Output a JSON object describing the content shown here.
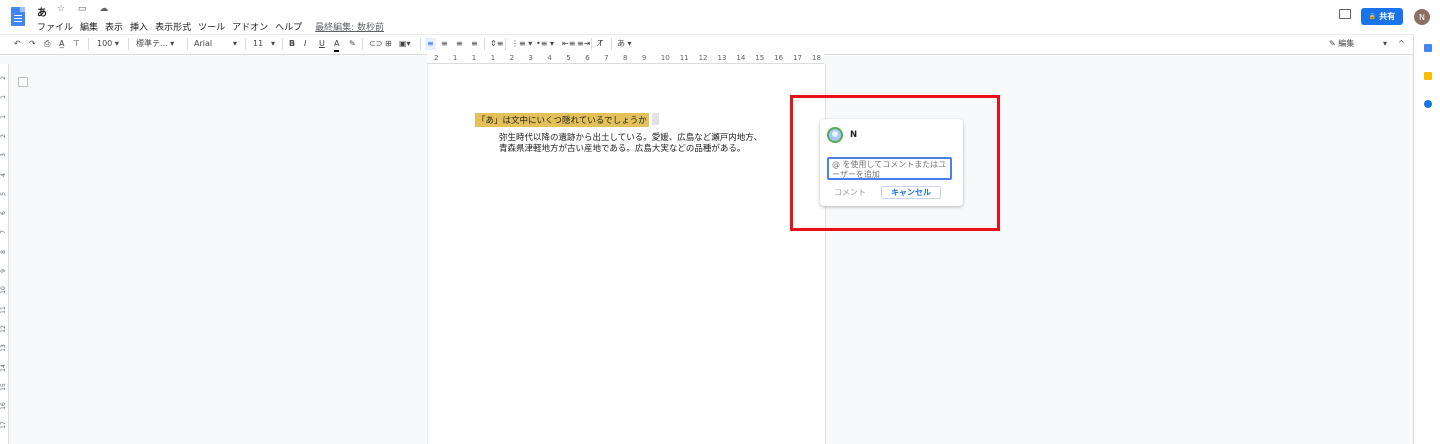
{
  "app": {
    "doc_title": "あ",
    "title_icons": "☆ ▭ ☁"
  },
  "menu": {
    "items": [
      "ファイル",
      "編集",
      "表示",
      "挿入",
      "表示形式",
      "ツール",
      "アドオン",
      "ヘルプ"
    ],
    "last_edit": "最終編集: 数秒前"
  },
  "header": {
    "share_label": "共有",
    "lock_glyph": "🔒",
    "avatar_initial": "N"
  },
  "toolbar": {
    "undo": "↶",
    "redo": "↷",
    "print": "⎙",
    "spell": "A̲",
    "paint": "⊤",
    "zoom": "100 ▾",
    "style": "標準テ... ▾",
    "font": "Arial",
    "font_arrow": "▾",
    "size": "11",
    "size_arrow": "▾",
    "bold": "B",
    "italic": "I",
    "underline": "U",
    "textcolor": "A",
    "highlight": "✎",
    "link": "⊂⊃",
    "comment": "⊞",
    "image": "▣▾",
    "align_left": "≡",
    "align_center": "≡",
    "align_right": "≡",
    "align_justify": "≡",
    "line_spacing": "⇕≡",
    "numbered_list": "⋮≡ ▾",
    "bulleted_list": "•≡ ▾",
    "indent_dec": "⇤≡",
    "indent_inc": "≡⇥",
    "clear_format": "T̸",
    "input_tool": "あ ▾",
    "edit_mode": "✎ 編集",
    "edit_mode_arrow": "▾",
    "collapse": "^"
  },
  "ruler": {
    "h_labels": [
      "2",
      "1",
      "1",
      "1",
      "2",
      "3",
      "4",
      "5",
      "6",
      "7",
      "8",
      "9",
      "10",
      "11",
      "12",
      "13",
      "14",
      "15",
      "16",
      "17",
      "18"
    ],
    "v_labels": [
      "2",
      "1",
      "1",
      "2",
      "3",
      "4",
      "5",
      "6",
      "7",
      "8",
      "9",
      "10",
      "11",
      "12",
      "13",
      "14",
      "15",
      "16",
      "17"
    ]
  },
  "document": {
    "heading": "「あ」は文中にいくつ隠れているでしょうか",
    "body": "弥生時代以降の遺跡から出土している。愛媛、広島など瀬戸内地方、青森県津軽地方が古い産地である。広島大実などの品種がある。"
  },
  "comment_box": {
    "author": "N",
    "placeholder": "@ を使用してコメントまたはユーザーを追加",
    "comment_label": "コメント",
    "cancel_label": "キャンセル"
  },
  "colors": {
    "accent": "#1a73e8",
    "highlight": "#e3c158",
    "annotation_box": "#e8101a"
  }
}
